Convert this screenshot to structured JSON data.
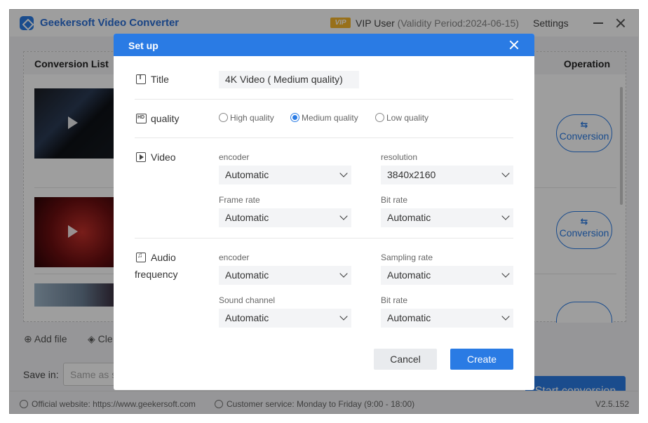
{
  "app": {
    "title": "Geekersoft Video Converter",
    "vip_badge": "VIP",
    "vip_user": "VIP User",
    "validity": "(Validity Period:2024-06-15)",
    "settings": "Settings"
  },
  "list": {
    "header_title": "Conversion List",
    "header_operation": "Operation",
    "items": [
      {
        "button_label": "Conversion"
      },
      {
        "button_label": "Conversion"
      }
    ]
  },
  "toolbar": {
    "add_file": "Add file",
    "clear": "Cle"
  },
  "save": {
    "label": "Save in:",
    "placeholder": "Same as s"
  },
  "start_button": "Start conversion",
  "footer": {
    "website": "Official website: https://www.geekersoft.com",
    "service": "Customer service: Monday to Friday (9:00 - 18:00)",
    "version": "V2.5.152"
  },
  "dialog": {
    "title": "Set up",
    "title_label": "Title",
    "title_value": "4K Video ( Medium quality)",
    "quality_label": "quality",
    "quality_options": [
      "High quality",
      "Medium quality",
      "Low quality"
    ],
    "quality_selected": "Medium quality",
    "video_label": "Video",
    "video": {
      "encoder_label": "encoder",
      "encoder_value": "Automatic",
      "resolution_label": "resolution",
      "resolution_value": "3840x2160",
      "framerate_label": "Frame rate",
      "framerate_value": "Automatic",
      "bitrate_label": "Bit rate",
      "bitrate_value": "Automatic"
    },
    "audio_label_1": "Audio",
    "audio_label_2": "frequency",
    "audio": {
      "encoder_label": "encoder",
      "encoder_value": "Automatic",
      "sampling_label": "Sampling rate",
      "sampling_value": "Automatic",
      "channel_label": "Sound channel",
      "channel_value": "Automatic",
      "bitrate_label": "Bit rate",
      "bitrate_value": "Automatic"
    },
    "cancel": "Cancel",
    "create": "Create"
  },
  "colors": {
    "accent": "#2a7be4",
    "vip": "#f5b52a"
  }
}
